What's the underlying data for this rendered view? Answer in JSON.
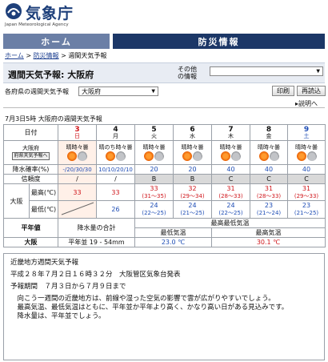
{
  "agency": {
    "name_jp": "気象庁",
    "name_en": "Japan Meteorological Agency"
  },
  "nav": {
    "home": "ホーム",
    "bosai": "防災情報"
  },
  "breadcrumb": {
    "home": "ホーム",
    "bosai": "防災情報",
    "current": "週間天気予報",
    "sep": ">"
  },
  "title": "週間天気予報: 大阪府",
  "other_info": {
    "label_line1": "その他",
    "label_line2": "の情報",
    "selected": ""
  },
  "pref_select": {
    "label": "各府県の週間天気予報",
    "selected": "大阪府"
  },
  "buttons": {
    "print": "印刷",
    "reload": "再読込",
    "explain": "説明へ"
  },
  "announce": "7月3日5時 大阪府の週間天気予報",
  "forecast": {
    "date_header": "日付",
    "area_label": "大阪府",
    "area_btn": "府県天気予報へ",
    "precip_label": "降水確率(%)",
    "reliability_label": "信頼度",
    "city_label": "大阪",
    "max_label": "最高(℃)",
    "min_label": "最低(℃)",
    "days": [
      {
        "day": "3",
        "dow": "日",
        "weather": "晴時々曇",
        "precip": "-/20/30/30",
        "reliability": "/",
        "max": "33",
        "max_range": "",
        "min": "",
        "min_range": ""
      },
      {
        "day": "4",
        "dow": "月",
        "weather": "晴のち時々曇",
        "precip": "10/10/20/10",
        "reliability": "/",
        "max": "33",
        "max_range": "",
        "min": "26",
        "min_range": ""
      },
      {
        "day": "5",
        "dow": "火",
        "weather": "晴時々曇",
        "precip": "20",
        "reliability": "B",
        "max": "33",
        "max_range": "(31～35)",
        "min": "24",
        "min_range": "(22～25)"
      },
      {
        "day": "6",
        "dow": "水",
        "weather": "晴時々曇",
        "precip": "20",
        "reliability": "B",
        "max": "32",
        "max_range": "(29～34)",
        "min": "24",
        "min_range": "(21～25)"
      },
      {
        "day": "7",
        "dow": "木",
        "weather": "晴時々曇",
        "precip": "40",
        "reliability": "C",
        "max": "31",
        "max_range": "(28～33)",
        "min": "24",
        "min_range": "(22～25)"
      },
      {
        "day": "8",
        "dow": "金",
        "weather": "晴時々曇",
        "precip": "40",
        "reliability": "C",
        "max": "31",
        "max_range": "(28～33)",
        "min": "23",
        "min_range": "(21～24)"
      },
      {
        "day": "9",
        "dow": "土",
        "weather": "晴時々曇",
        "precip": "40",
        "reliability": "C",
        "max": "31",
        "max_range": "(29～33)",
        "min": "23",
        "min_range": "(21～25)"
      }
    ]
  },
  "summary": {
    "normal_label": "平年値",
    "precip_sum_label": "降水量の合計",
    "maxmin_header": "最高最低気温",
    "min_label": "最低気温",
    "max_label": "最高気温",
    "city": "大阪",
    "precip_value": "平年並 19 - 54mm",
    "min_value": "23.0 ℃",
    "max_value": "30.1 ℃"
  },
  "text": {
    "heading": "近畿地方週間天気予報",
    "issued": "平成２８年７月２日１６時３２分　大阪管区気象台発表",
    "period": "予報期間　７月３日から７月９日まで",
    "body1": "　向こう一週間の近畿地方は、前線や湿った空気の影響で雲が広がりやすいでしょう。",
    "body2": "　最高気温、最低気温はともに、平年並か平年より高く、かなり高い日がある見込みです。",
    "body3": "　降水量は、平年並でしょう。"
  }
}
